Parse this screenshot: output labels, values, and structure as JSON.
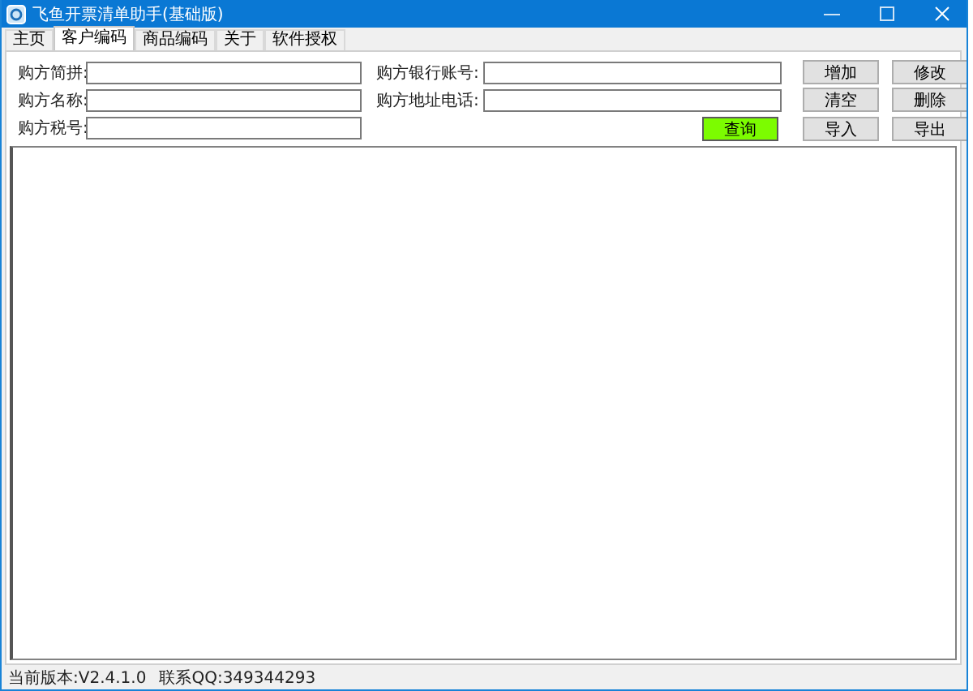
{
  "window": {
    "title": "飞鱼开票清单助手(基础版)"
  },
  "tabs": [
    {
      "label": "主页",
      "selected": false
    },
    {
      "label": "客户编码",
      "selected": true
    },
    {
      "label": "商品编码",
      "selected": false
    },
    {
      "label": "关于",
      "selected": false
    },
    {
      "label": "软件授权",
      "selected": false
    }
  ],
  "form": {
    "left": [
      {
        "label": "购方简拼:"
      },
      {
        "label": "购方名称:"
      },
      {
        "label": "购方税号:"
      }
    ],
    "right": [
      {
        "label": "购方银行账号:"
      },
      {
        "label": "购方地址电话:"
      }
    ]
  },
  "query_button": "查询",
  "buttons": [
    "增加",
    "修改",
    "清空",
    "删除",
    "导入",
    "导出"
  ],
  "status_bar": {
    "version": "当前版本:V2.4.1.0",
    "contact": "联系QQ:349344293"
  }
}
